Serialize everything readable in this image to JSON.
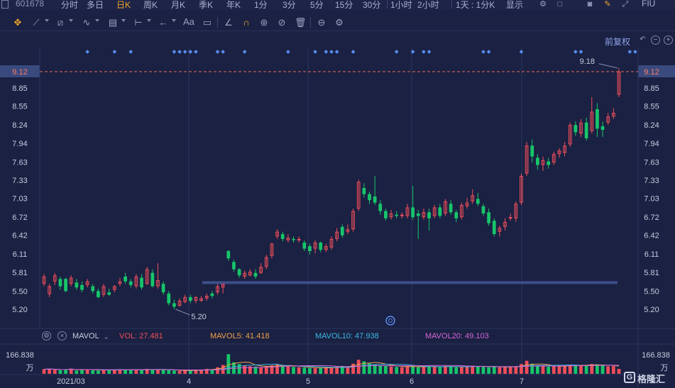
{
  "toolbar": {
    "code": "601678",
    "periods": [
      "分时",
      "多日",
      "日K",
      "周K",
      "月K",
      "季K",
      "年K",
      "1分",
      "3分",
      "5分",
      "15分",
      "30分",
      "1小时",
      "2小时",
      "1天 : 1分K",
      "显示"
    ],
    "active_period": "日K",
    "right_label": "FIU"
  },
  "drawing_tools": [
    "move-icon",
    "line-icon",
    "channel-icon",
    "wave-icon",
    "fib-icon",
    "range-icon",
    "arrow-icon",
    "text-icon",
    "note-icon",
    "measure-icon",
    "magnet-icon",
    "hide-icon",
    "lock-icon",
    "delete-icon",
    "compare-icon",
    "settings-icon"
  ],
  "text_tool_label": "Aa",
  "restore_label": "前复权",
  "chart_data": {
    "type": "candlestick",
    "title": "",
    "y_axis_ticks": [
      9.12,
      8.85,
      8.55,
      8.24,
      7.94,
      7.63,
      7.33,
      7.03,
      6.72,
      6.42,
      6.11,
      5.81,
      5.5,
      5.2
    ],
    "current_price": 9.12,
    "high_label": "9.18",
    "low_label": "5.20",
    "x_ticks": [
      "2021/03",
      "4",
      "5",
      "6",
      "7"
    ],
    "candles": [
      [
        5.62,
        5.74,
        5.78,
        5.58
      ],
      [
        5.45,
        5.58,
        5.62,
        5.4
      ],
      [
        5.66,
        5.76,
        5.8,
        5.6
      ],
      [
        5.7,
        5.58,
        5.74,
        5.52
      ],
      [
        5.7,
        5.5,
        5.72,
        5.48
      ],
      [
        5.62,
        5.72,
        5.76,
        5.58
      ],
      [
        5.64,
        5.56,
        5.7,
        5.52
      ],
      [
        5.6,
        5.52,
        5.66,
        5.48
      ],
      [
        5.6,
        5.66,
        5.7,
        5.56
      ],
      [
        5.58,
        5.5,
        5.62,
        5.46
      ],
      [
        5.5,
        5.4,
        5.54,
        5.38
      ],
      [
        5.44,
        5.58,
        5.62,
        5.4
      ],
      [
        5.48,
        5.44,
        5.54,
        5.42
      ],
      [
        5.52,
        5.58,
        5.6,
        5.48
      ],
      [
        5.62,
        5.66,
        5.72,
        5.58
      ],
      [
        5.74,
        5.66,
        5.8,
        5.62
      ],
      [
        5.66,
        5.6,
        5.7,
        5.56
      ],
      [
        5.58,
        5.74,
        5.78,
        5.54
      ],
      [
        5.72,
        5.56,
        5.78,
        5.52
      ],
      [
        5.62,
        5.86,
        5.9,
        5.6
      ],
      [
        5.8,
        5.58,
        5.86,
        5.56
      ],
      [
        5.58,
        5.68,
        5.96,
        5.54
      ],
      [
        5.62,
        5.48,
        5.66,
        5.44
      ],
      [
        5.46,
        5.3,
        5.5,
        5.26
      ],
      [
        5.3,
        5.24,
        5.36,
        5.2
      ],
      [
        5.26,
        5.34,
        5.38,
        5.24
      ],
      [
        5.32,
        5.4,
        5.44,
        5.3
      ],
      [
        5.4,
        5.34,
        5.44,
        5.3
      ],
      [
        5.34,
        5.4,
        5.42,
        5.3
      ],
      [
        5.34,
        5.38,
        5.42,
        5.32
      ],
      [
        5.38,
        5.42,
        5.46,
        5.34
      ],
      [
        5.46,
        5.42,
        5.5,
        5.38
      ],
      [
        5.48,
        5.58,
        5.62,
        5.44
      ],
      [
        5.56,
        5.62,
        5.62,
        5.46
      ],
      [
        6.16,
        6.04,
        6.18,
        6.0
      ],
      [
        5.98,
        5.86,
        6.02,
        5.82
      ],
      [
        5.86,
        5.76,
        5.88,
        5.72
      ],
      [
        5.74,
        5.8,
        5.84,
        5.7
      ],
      [
        5.76,
        5.82,
        5.86,
        5.74
      ],
      [
        5.8,
        5.74,
        5.86,
        5.7
      ],
      [
        5.8,
        5.9,
        5.96,
        5.78
      ],
      [
        5.9,
        6.06,
        6.1,
        5.86
      ],
      [
        6.08,
        6.28,
        6.3,
        6.04
      ],
      [
        6.4,
        6.48,
        6.52,
        6.36
      ],
      [
        6.44,
        6.36,
        6.48,
        6.32
      ],
      [
        6.34,
        6.38,
        6.44,
        6.3
      ],
      [
        6.36,
        6.34,
        6.4,
        6.3
      ],
      [
        6.34,
        6.36,
        6.4,
        6.3
      ],
      [
        6.3,
        6.2,
        6.34,
        6.16
      ],
      [
        6.24,
        6.16,
        6.28,
        6.1
      ],
      [
        6.2,
        6.3,
        6.34,
        6.12
      ],
      [
        6.3,
        6.18,
        6.32,
        6.14
      ],
      [
        6.18,
        6.24,
        6.28,
        6.14
      ],
      [
        6.22,
        6.36,
        6.4,
        6.18
      ],
      [
        6.36,
        6.48,
        6.54,
        6.32
      ],
      [
        6.56,
        6.42,
        6.6,
        6.38
      ],
      [
        6.48,
        6.52,
        6.6,
        6.44
      ],
      [
        6.52,
        6.82,
        6.86,
        6.48
      ],
      [
        6.86,
        7.3,
        7.34,
        6.82
      ],
      [
        7.2,
        7.1,
        7.28,
        7.04
      ],
      [
        7.1,
        7.0,
        7.14,
        6.94
      ],
      [
        7.06,
        6.96,
        7.4,
        6.92
      ],
      [
        6.94,
        6.82,
        7.0,
        6.76
      ],
      [
        6.82,
        6.7,
        6.86,
        6.66
      ],
      [
        6.72,
        6.78,
        6.84,
        6.68
      ],
      [
        6.76,
        6.74,
        6.82,
        6.7
      ],
      [
        6.74,
        6.76,
        6.8,
        6.7
      ],
      [
        6.74,
        6.88,
        6.94,
        6.7
      ],
      [
        6.88,
        6.72,
        7.24,
        6.68
      ],
      [
        6.78,
        6.74,
        6.84,
        6.36
      ],
      [
        6.72,
        6.8,
        6.86,
        6.68
      ],
      [
        6.8,
        6.7,
        6.86,
        6.5
      ],
      [
        6.74,
        6.88,
        6.92,
        6.7
      ],
      [
        6.88,
        6.74,
        6.94,
        6.7
      ],
      [
        6.78,
        6.98,
        7.02,
        6.74
      ],
      [
        6.94,
        6.8,
        7.0,
        6.76
      ],
      [
        6.8,
        6.7,
        6.84,
        6.64
      ],
      [
        6.72,
        6.92,
        6.96,
        6.68
      ],
      [
        6.9,
        6.96,
        7.04,
        6.86
      ],
      [
        6.98,
        7.08,
        7.18,
        6.94
      ],
      [
        7.02,
        6.94,
        7.12,
        6.9
      ],
      [
        6.9,
        6.78,
        6.94,
        6.74
      ],
      [
        6.8,
        6.62,
        6.86,
        6.58
      ],
      [
        6.66,
        6.44,
        6.7,
        6.4
      ],
      [
        6.48,
        6.54,
        6.58,
        6.4
      ],
      [
        6.56,
        6.64,
        6.7,
        6.5
      ],
      [
        6.7,
        6.72,
        6.78,
        6.66
      ],
      [
        6.7,
        6.94,
        6.98,
        6.64
      ],
      [
        6.96,
        7.4,
        7.44,
        6.92
      ],
      [
        7.44,
        7.9,
        7.96,
        7.4
      ],
      [
        7.9,
        7.72,
        8.0,
        7.62
      ],
      [
        7.7,
        7.58,
        7.76,
        7.5
      ],
      [
        7.58,
        7.66,
        7.72,
        7.48
      ],
      [
        7.64,
        7.58,
        7.7,
        7.52
      ],
      [
        7.62,
        7.76,
        7.8,
        7.58
      ],
      [
        7.76,
        7.82,
        7.86,
        7.7
      ],
      [
        7.78,
        7.9,
        7.96,
        7.72
      ],
      [
        7.92,
        8.24,
        8.28,
        7.88
      ],
      [
        8.24,
        8.12,
        8.3,
        8.06
      ],
      [
        8.1,
        8.28,
        8.34,
        8.04
      ],
      [
        8.28,
        8.02,
        8.36,
        7.98
      ],
      [
        8.14,
        8.46,
        8.7,
        8.1
      ],
      [
        8.5,
        8.18,
        8.6,
        8.04
      ],
      [
        8.22,
        8.16,
        8.3,
        8.04
      ],
      [
        8.28,
        8.38,
        8.44,
        8.24
      ],
      [
        8.38,
        8.44,
        8.52,
        8.34
      ],
      [
        8.74,
        9.12,
        9.18,
        8.7
      ]
    ],
    "support_line": 5.64,
    "indicators": {
      "name": "MAVOL",
      "vol": "VOL: 27.481",
      "mavol5": "MAVOL5: 41.418",
      "mavol10": "MAVOL10: 47.938",
      "mavol20": "MAVOL20: 49.103",
      "colors": {
        "vol": "#ef4e5a",
        "mavol5": "#f0a04a",
        "mavol10": "#3db7e6",
        "mavol20": "#d565d8"
      }
    },
    "volume_max_label": "166.838",
    "volume_unit": "万",
    "volume_values": [
      28,
      30,
      26,
      22,
      24,
      32,
      20,
      26,
      28,
      22,
      20,
      24,
      22,
      26,
      28,
      24,
      22,
      26,
      24,
      30,
      28,
      26,
      24,
      22,
      20,
      18,
      20,
      22,
      24,
      26,
      30,
      28,
      40,
      54,
      120,
      70,
      60,
      50,
      46,
      44,
      40,
      48,
      52,
      58,
      50,
      46,
      42,
      40,
      38,
      36,
      34,
      36,
      38,
      40,
      46,
      48,
      44,
      62,
      86,
      76,
      64,
      58,
      52,
      48,
      44,
      42,
      40,
      46,
      50,
      40,
      42,
      44,
      46,
      42,
      48,
      44,
      40,
      44,
      46,
      50,
      48,
      42,
      40,
      44,
      40,
      42,
      44,
      46,
      60,
      80,
      62,
      50,
      46,
      44,
      46,
      48,
      50,
      56,
      52,
      54,
      50,
      60,
      58,
      50,
      46,
      48,
      30
    ]
  },
  "colors": {
    "up": "#ef4e5a",
    "down": "#17c56a",
    "price_line": "#e86a5a",
    "accent": "#f2a628",
    "grid": "#2b3560",
    "background": "#1a2142"
  },
  "watermark": "格隆汇"
}
